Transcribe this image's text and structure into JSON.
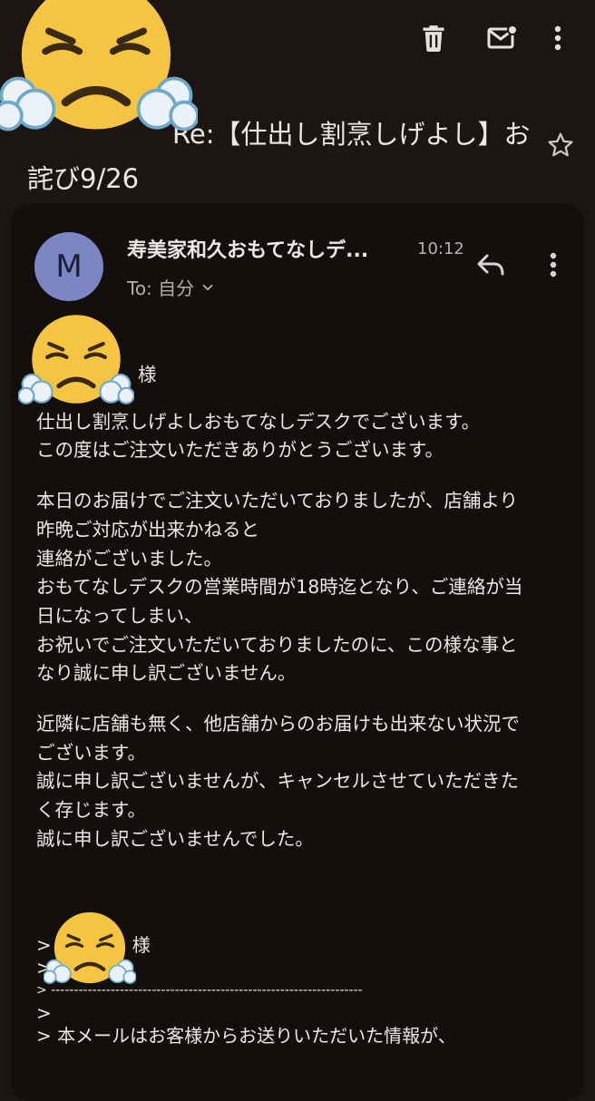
{
  "toolbar": {
    "icons": [
      "trash-icon",
      "mark-unread-icon",
      "more-vert-icon"
    ],
    "colors": {
      "icon": "#e6e1dd",
      "background": "#1b1613"
    }
  },
  "subject": {
    "text": "Re:【仕出し割烹しげよし】お詫び9/26"
  },
  "message": {
    "avatar_letter": "M",
    "sender": "寿美家和久おもてなしデ...",
    "time": "10:12",
    "to_label": "To: 自分",
    "salutation_suffix": "様",
    "paragraphs": [
      "仕出し割烹しげよしおもてなしデスクでございます。\nこの度はご注文いただきありがとうございます。",
      "本日のお届けでご注文いただいておりましたが、店舗より\n昨晩ご対応が出来かねると\n連絡がございました。\nおもてなしデスクの営業時間が18時迄となり、ご連絡が当\n日になってしまい、\nお祝いでご注文いただいておりましたのに、この様な事と\nなり誠に申し訳ございません。",
      "近隣に店舗も無く、他店舗からのお届けも出来ない状況で\nございます。\n誠に申し訳ございませんが、キャンセルさせていただきた\nく存じます。\n誠に申し訳ございませんでした。"
    ],
    "quote": {
      "salutation_suffix": "様",
      "lines": [
        ">",
        "> --------------------------------------------------------------------",
        ">",
        "> 本メールはお客様からお送りいただいた情報が、"
      ]
    },
    "colors": {
      "avatar": "#7c86c2",
      "card": "#130f0d"
    }
  },
  "stickers": [
    "steam-from-nose-face-emoji",
    "steam-from-nose-face-emoji",
    "steam-from-nose-face-emoji"
  ]
}
